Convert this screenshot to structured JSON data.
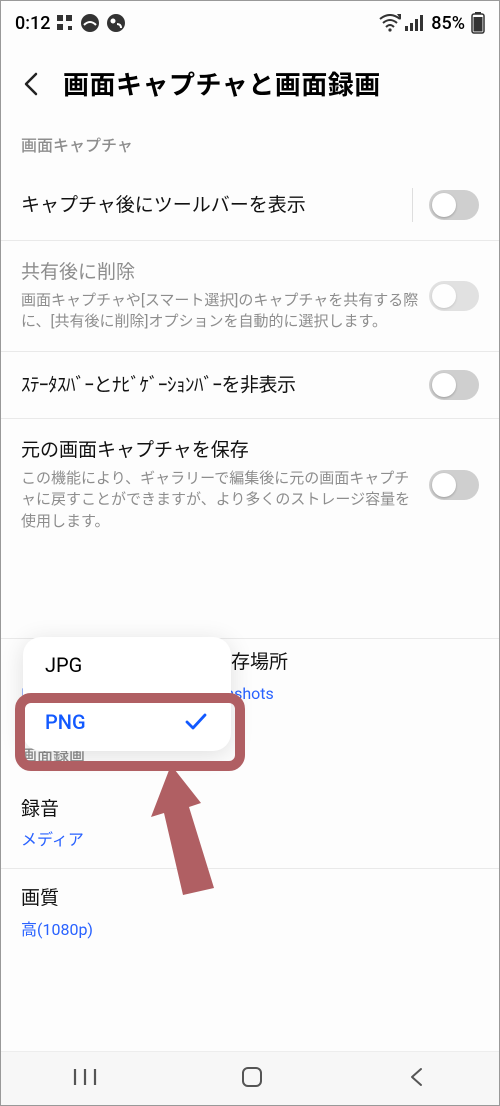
{
  "status_bar": {
    "time": "0:12",
    "battery_pct": "85%"
  },
  "header": {
    "title": "画面キャプチャと画面録画"
  },
  "sections": {
    "capture_label": "画面キャプチャ",
    "record_label": "画面録画"
  },
  "rows": {
    "toolbar": {
      "title": "キャプチャ後にツールバーを表示"
    },
    "delete_after_share": {
      "title": "共有後に削除",
      "sub": "画面キャプチャや[スマート選択]のキャプチャを共有する際に、[共有後に削除]オプションを自動的に選択します。"
    },
    "hide_bars": {
      "title": "ｽﾃｰﾀｽﾊﾞｰとﾅﾋﾞｹﾞｰｼｮﾝﾊﾞｰを非表示"
    },
    "save_original": {
      "title": "元の画面キャプチャを保存",
      "sub": "この機能により、ギャラリーで編集後に元の画面キャプチャに戻すことができますが、より多くのストレージ容量を使用します。"
    },
    "save_location": {
      "title_suffix": "存場所",
      "value": "内部ストレージ/DCIM/Screenshots"
    },
    "audio": {
      "title": "録音",
      "value": "メディア"
    },
    "quality": {
      "title": "画質",
      "value": "高(1080p)"
    }
  },
  "popup": {
    "options": [
      "JPG",
      "PNG"
    ],
    "selected_index": 1
  }
}
